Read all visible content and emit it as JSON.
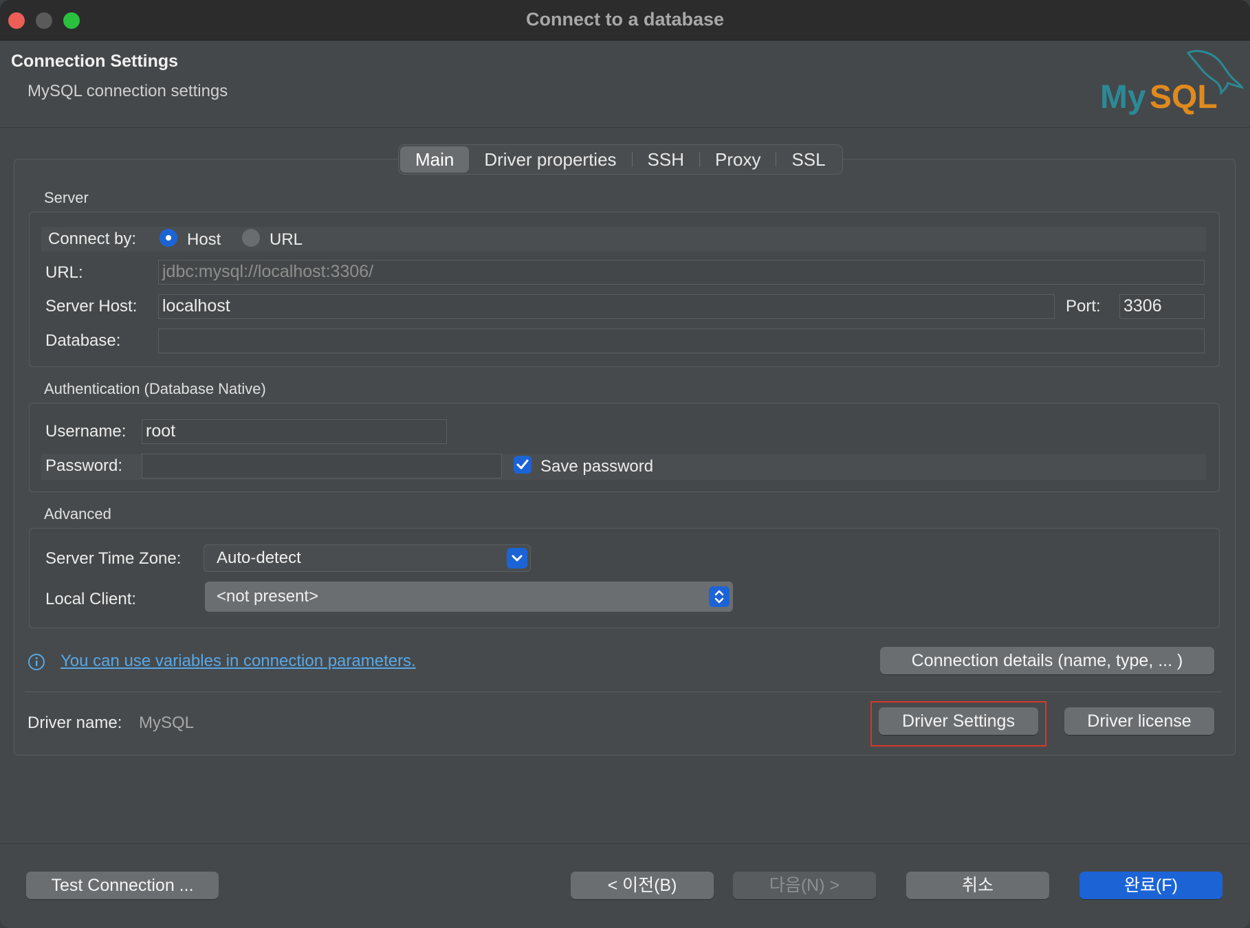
{
  "window": {
    "title": "Connect to a database"
  },
  "header": {
    "title": "Connection Settings",
    "subtitle": "MySQL connection settings",
    "logo_text": "MySQL"
  },
  "tabs": [
    {
      "label": "Main",
      "active": true
    },
    {
      "label": "Driver properties",
      "active": false
    },
    {
      "label": "SSH",
      "active": false
    },
    {
      "label": "Proxy",
      "active": false
    },
    {
      "label": "SSL",
      "active": false
    }
  ],
  "server": {
    "group_title": "Server",
    "connect_by_label": "Connect by:",
    "host_option": "Host",
    "url_option": "URL",
    "selected": "Host",
    "url_label": "URL:",
    "url_value": "jdbc:mysql://localhost:3306/",
    "host_label": "Server Host:",
    "host_value": "localhost",
    "port_label": "Port:",
    "port_value": "3306",
    "database_label": "Database:",
    "database_value": ""
  },
  "auth": {
    "group_title": "Authentication (Database Native)",
    "username_label": "Username:",
    "username_value": "root",
    "password_label": "Password:",
    "password_value": "",
    "save_password_label": "Save password",
    "save_password_checked": true
  },
  "advanced": {
    "group_title": "Advanced",
    "timezone_label": "Server Time Zone:",
    "timezone_value": "Auto-detect",
    "local_client_label": "Local Client:",
    "local_client_value": "<not present>"
  },
  "info": {
    "link_text": "You can use variables in connection parameters.",
    "connection_details_button": "Connection details (name, type, ... )"
  },
  "driver": {
    "name_label": "Driver name:",
    "name_value": "MySQL",
    "settings_button": "Driver Settings",
    "license_button": "Driver license"
  },
  "footer": {
    "test_connection": "Test Connection ...",
    "back": "< 이전(B)",
    "next": "다음(N) >",
    "cancel": "취소",
    "finish": "완료(F)"
  },
  "colors": {
    "accent": "#1c64d6",
    "link": "#58a8e8",
    "highlight": "#d8372a",
    "logo_teal": "#2a8a96",
    "logo_orange": "#e08a1e"
  }
}
